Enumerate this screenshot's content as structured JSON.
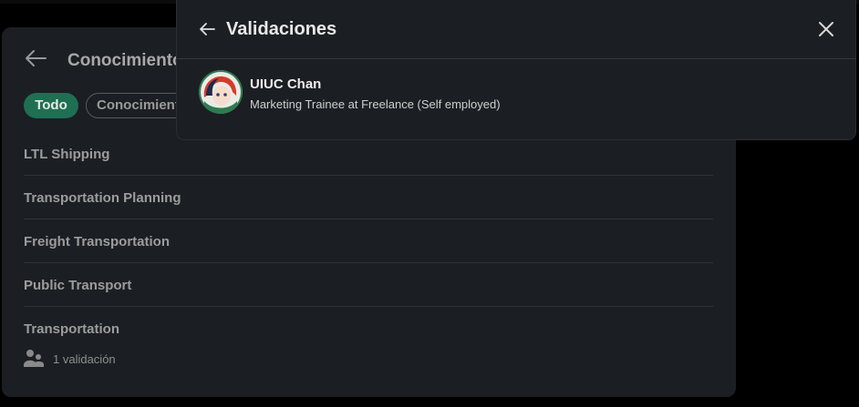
{
  "panel": {
    "title": "Conocimientos",
    "filters": [
      {
        "label": "Todo",
        "active": true
      },
      {
        "label": "Conocimientos del sector",
        "active": false
      }
    ],
    "skills": [
      {
        "name": "LTL Shipping"
      },
      {
        "name": "Transportation Planning"
      },
      {
        "name": "Freight Transportation"
      },
      {
        "name": "Public Transport"
      },
      {
        "name": "Transportation"
      }
    ],
    "endorsement": "1 validación"
  },
  "modal": {
    "title": "Validaciones",
    "endorser": {
      "name": "UIUC Chan",
      "headline": "Marketing Trainee at Freelance (Self employed)",
      "avatar_icon": "anime-avatar-icon"
    }
  },
  "colors": {
    "background": "#000000",
    "surface": "#1b1f23",
    "accent_green": "#1f6f53",
    "text_primary": "#e8e8e8",
    "text_muted": "#9c9c9c"
  }
}
